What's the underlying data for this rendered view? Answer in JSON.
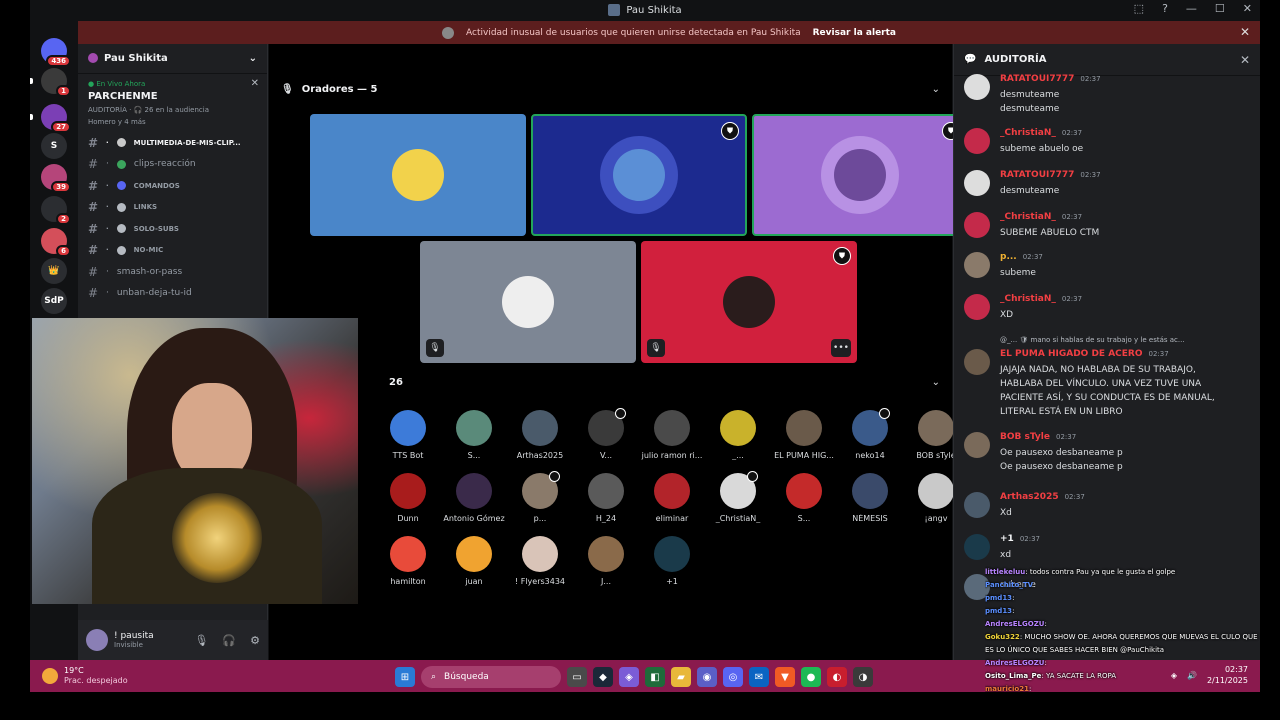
{
  "window": {
    "title": "Pau Shikita",
    "controls": [
      "⬚",
      "?",
      "—",
      "☐",
      "✕"
    ]
  },
  "alert": {
    "text": "Actividad inusual de usuarios que quieren unirse detectada en Pau Shikita",
    "action": "Revisar la alerta"
  },
  "servers": [
    {
      "label": "",
      "color": "#5865f2",
      "badge": "436"
    },
    {
      "label": "",
      "color": "#3a3a3a",
      "badge": "1"
    },
    {
      "label": "",
      "color": "#7b3fb5",
      "badge": "27"
    },
    {
      "label": "S",
      "color": "#2b2d31",
      "badge": ""
    },
    {
      "label": "",
      "color": "#b5457a",
      "badge": "39"
    },
    {
      "label": "",
      "color": "#2b2d31",
      "badge": "2"
    },
    {
      "label": "",
      "color": "#d44f5a",
      "badge": "6"
    },
    {
      "label": "👑",
      "color": "#2b2d31",
      "badge": ""
    },
    {
      "label": "SdP",
      "color": "#2b2d31",
      "badge": ""
    }
  ],
  "sidebar": {
    "server_name": "Pau Shikita",
    "live_label": "● En Vivo Ahora",
    "stage_name": "PARCHENME",
    "stage_meta": "AUDITORÍA · 🎧 26 en la audiencia",
    "stage_people": "Homero y 4 más",
    "channels": [
      {
        "name": "multimedia-de-mis-clip...",
        "color": "#c9c9c9",
        "small": true,
        "active": true
      },
      {
        "name": "clips-reacción",
        "color": "#3ba55d",
        "small": false,
        "active": false
      },
      {
        "name": "comandos",
        "color": "#5865f2",
        "small": true,
        "active": false
      },
      {
        "name": "links",
        "color": "#b5bac1",
        "small": true,
        "active": false
      },
      {
        "name": "solo-subs",
        "color": "#b5bac1",
        "small": true,
        "active": false
      },
      {
        "name": "no-mic",
        "color": "#b5bac1",
        "small": true,
        "active": false
      },
      {
        "name": "smash-or-pass",
        "color": "",
        "small": false,
        "active": false
      },
      {
        "name": "unban-deja-tu-id",
        "color": "",
        "small": false,
        "active": false
      }
    ],
    "user": {
      "name": "! pausita",
      "status": "Invisible"
    }
  },
  "stage": {
    "speakers_label": "Oradores — 5",
    "audience_count": "26",
    "speaker_tiles": [
      {
        "bg": "#4a86c9",
        "avatar": "#f2d24b",
        "ring": "",
        "mod": false,
        "mute": false,
        "more": false,
        "border": ""
      },
      {
        "bg": "#1c2a8f",
        "avatar": "#5b8fd6",
        "ring": "#3d4fbf",
        "mod": true,
        "mute": false,
        "more": false,
        "border": "#23a55a"
      },
      {
        "bg": "#9c6bd1",
        "avatar": "#6d4a9a",
        "ring": "#b891e4",
        "mod": true,
        "mute": false,
        "more": false,
        "border": "#23a55a"
      },
      {
        "bg": "#7d8694",
        "avatar": "#eeeeee",
        "ring": "",
        "mod": false,
        "mute": true,
        "more": false,
        "border": ""
      },
      {
        "bg": "#d1203d",
        "avatar": "#2a1c1c",
        "ring": "",
        "mod": true,
        "mute": true,
        "more": true,
        "border": ""
      }
    ],
    "audience": [
      {
        "name": "TTS Bot",
        "color": "#3d7bd9",
        "dot": false
      },
      {
        "name": "S...",
        "color": "#5a8a7a",
        "dot": false
      },
      {
        "name": "Arthas2025",
        "color": "#4a5a6a",
        "dot": false
      },
      {
        "name": "V...",
        "color": "#3a3a3a",
        "dot": true
      },
      {
        "name": "julio ramon ri...",
        "color": "#4a4a4a",
        "dot": false
      },
      {
        "name": "_...",
        "color": "#c9b22b",
        "dot": false
      },
      {
        "name": "EL PUMA HIG...",
        "color": "#6a5a4a",
        "dot": false
      },
      {
        "name": "neko14",
        "color": "#3a5a8a",
        "dot": true
      },
      {
        "name": "BOB sTyle",
        "color": "#7a6a5a",
        "dot": false
      },
      {
        "name": "Dunn",
        "color": "#a81c1c",
        "dot": false
      },
      {
        "name": "Antonio Gómez",
        "color": "#3a2a4a",
        "dot": false
      },
      {
        "name": "p...",
        "color": "#8a7a6a",
        "dot": true
      },
      {
        "name": "H_24",
        "color": "#5a5a5a",
        "dot": false
      },
      {
        "name": "eliminar",
        "color": "#b2242a",
        "dot": false
      },
      {
        "name": "_ChristiaN_",
        "color": "#d9d9d9",
        "dot": true
      },
      {
        "name": "S...",
        "color": "#c42a2a",
        "dot": false
      },
      {
        "name": "NÉMESIS",
        "color": "#3a4a6a",
        "dot": false
      },
      {
        "name": "¡angv",
        "color": "#c9c9c9",
        "dot": false
      },
      {
        "name": "hamilton",
        "color": "#e84b3a",
        "dot": false
      },
      {
        "name": "juan",
        "color": "#f0a330",
        "dot": false
      },
      {
        "name": "! Flyers3434",
        "color": "#d9c4b8",
        "dot": false
      },
      {
        "name": "J...",
        "color": "#8a6a4a",
        "dot": false
      },
      {
        "name": "+1",
        "color": "#1a3a4a",
        "dot": false
      }
    ]
  },
  "audit": {
    "title": "AUDITORÍA",
    "messages": [
      {
        "user": "RATATOUI7777",
        "time": "02:37",
        "color": "#f23f43",
        "avatar": "#dddddd",
        "lines": [
          "desmuteame",
          "desmuteame"
        ]
      },
      {
        "user": "_ChristiaN_",
        "time": "02:37",
        "color": "#f23f43",
        "avatar": "#c42a4a",
        "lines": [
          "subeme abuelo oe"
        ]
      },
      {
        "user": "RATATOUI7777",
        "time": "02:37",
        "color": "#f23f43",
        "avatar": "#dddddd",
        "lines": [
          "desmuteame"
        ]
      },
      {
        "user": "_ChristiaN_",
        "time": "02:37",
        "color": "#f23f43",
        "avatar": "#c42a4a",
        "lines": [
          "SUBEME ABUELO CTM"
        ]
      },
      {
        "user": "p...",
        "time": "02:37",
        "color": "#f0b232",
        "avatar": "#8a7a6a",
        "lines": [
          "subeme"
        ]
      },
      {
        "user": "_ChristiaN_",
        "time": "02:37",
        "color": "#f23f43",
        "avatar": "#c42a4a",
        "lines": [
          "XD"
        ]
      },
      {
        "user": "EL PUMA HIGADO DE ACERO",
        "time": "02:37",
        "color": "#f23f43",
        "avatar": "#6a5a4a",
        "lines": [
          "JAJAJA NADA, NO HABLABA DE SU TRABAJO,",
          "HABLABA DEL VÍNCULO. UNA VEZ TUVE UNA",
          "PACIENTE ASÍ, Y SU CONDUCTA ES DE MANUAL,",
          "LITERAL ESTÁ EN UN LIBRO"
        ]
      },
      {
        "user": "BOB sTyle",
        "time": "02:37",
        "color": "#f23f43",
        "avatar": "#7a6a5a",
        "lines": [
          "Oe pausexo desbaneame p",
          "Oe pausexo desbaneame p"
        ]
      },
      {
        "user": "Arthas2025",
        "time": "02:37",
        "color": "#f23f43",
        "avatar": "#4a5a6a",
        "lines": [
          "Xd"
        ]
      },
      {
        "user": "+1",
        "time": "02:37",
        "color": "#f2f3f5",
        "avatar": "#1a3a4a",
        "lines": [
          "xd"
        ]
      },
      {
        "user": "",
        "time": "",
        "color": "#f2f3f5",
        "avatar": "#5a6a7a",
        "lines": [
          "subeme"
        ]
      }
    ],
    "reply_preview": "@_... 🛡 mano si hablas de su trabajo y le  estás ac..."
  },
  "twitch_chat": [
    {
      "user": "littlekeluu",
      "color": "#b884ff",
      "text": ": todos contra Pau ya que le gusta el golpe"
    },
    {
      "user": "Panchito_TV",
      "color": "#5b8fff",
      "text": ":"
    },
    {
      "user": "pmd13",
      "color": "#5b8fff",
      "text": ":"
    },
    {
      "user": "pmd13",
      "color": "#5b8fff",
      "text": ":"
    },
    {
      "user": "AndresELGOZU",
      "color": "#b884ff",
      "text": ":"
    },
    {
      "user": "Goku322",
      "color": "#f0d43a",
      "text": ": MUCHO SHOW OE. AHORA QUEREMOS QUE MUEVAS EL CULO QUE"
    },
    {
      "user": "",
      "color": "#ffffff",
      "text": "ES LO ÚNICO QUE SABES HACER BIEN  @PauChikita"
    },
    {
      "user": "AndresELGOZU",
      "color": "#b884ff",
      "text": ":"
    },
    {
      "user": "Osito_Lima_Pe",
      "color": "#ffffff",
      "text": ": YA SACATE LA ROPA"
    },
    {
      "user": "mauricio21",
      "color": "#f07a3a",
      "text": ":"
    }
  ],
  "taskbar": {
    "temp": "19°C",
    "weather": "Prac. despejado",
    "search_placeholder": "Búsqueda",
    "time": "02:37",
    "date": "2/11/2025",
    "apps": [
      {
        "icon": "▭",
        "color": "#4a4a4a"
      },
      {
        "icon": "◆",
        "color": "#1b2838"
      },
      {
        "icon": "◈",
        "color": "#7b5cd6"
      },
      {
        "icon": "◧",
        "color": "#1f6b3a"
      },
      {
        "icon": "▰",
        "color": "#e8b83a"
      },
      {
        "icon": "◉",
        "color": "#5b5fc7"
      },
      {
        "icon": "◎",
        "color": "#5865f2"
      },
      {
        "icon": "✉",
        "color": "#0a64c2"
      },
      {
        "icon": "▼",
        "color": "#f05a24"
      },
      {
        "icon": "●",
        "color": "#1db954"
      },
      {
        "icon": "◐",
        "color": "#c81e2e"
      },
      {
        "icon": "◑",
        "color": "#3a3a3a"
      }
    ]
  }
}
